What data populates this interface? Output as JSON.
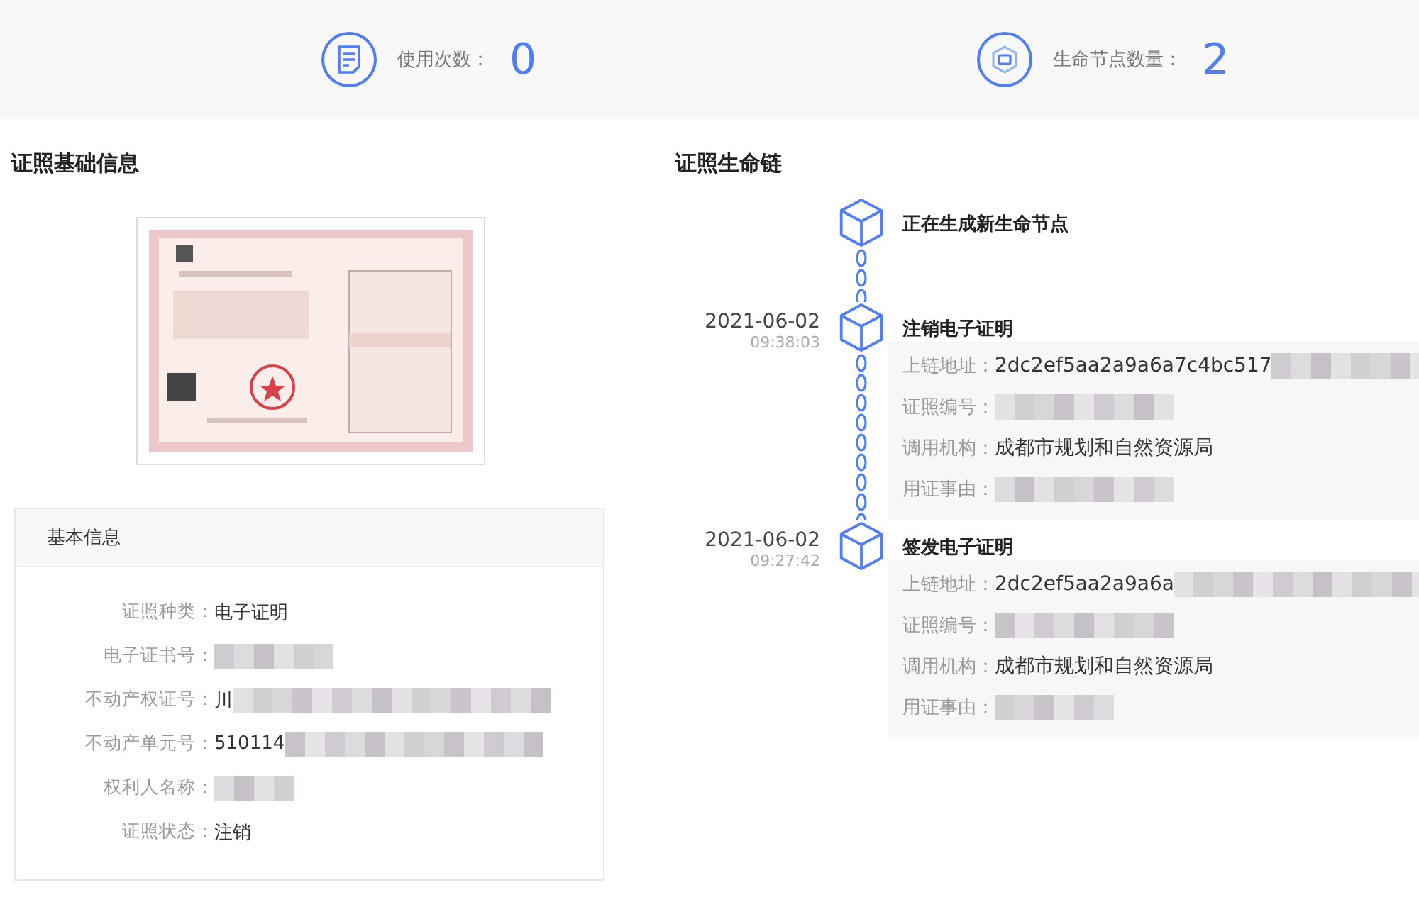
{
  "stats": [
    {
      "label": "使用次数：",
      "value": "0"
    },
    {
      "label": "生命节点数量：",
      "value": "2"
    }
  ],
  "certificate_info": {
    "title": "证照基础信息",
    "panel": {
      "title": "基本信息",
      "fields": [
        {
          "label": "证照种类：",
          "value": "电子证明",
          "redacted": false
        },
        {
          "label": "电子证书号：",
          "redacted": true
        },
        {
          "label": "不动产权证号：",
          "value": "川",
          "redacted": true
        },
        {
          "label": "不动产单元号：",
          "value": "510114",
          "redacted": true
        },
        {
          "label": "权利人名称：",
          "redacted": true
        },
        {
          "label": "证照状态：",
          "value": "注销",
          "redacted": false
        }
      ]
    }
  },
  "life_chain": {
    "title": "证照生命链",
    "nodes": [
      {
        "title": "正在生成新生命节点"
      },
      {
        "date": "2021-06-02",
        "time": "09:38:03",
        "title": "注销电子证明",
        "fields": [
          {
            "label": "上链地址：",
            "value": "2dc2ef5aa2a9a6a7c4bc517",
            "redacted": true
          },
          {
            "label": "证照编号：",
            "redacted": true
          },
          {
            "label": "调用机构：",
            "value": "成都市规划和自然资源局",
            "redacted": false
          },
          {
            "label": "用证事由：",
            "redacted": true
          }
        ]
      },
      {
        "date": "2021-06-02",
        "time": "09:27:42",
        "title": "签发电子证明",
        "fields": [
          {
            "label": "上链地址：",
            "value": "2dc2ef5aa2a9a6a",
            "redacted": true
          },
          {
            "label": "证照编号：",
            "redacted": true
          },
          {
            "label": "调用机构：",
            "value": "成都市规划和自然资源局",
            "redacted": false
          },
          {
            "label": "用证事由：",
            "redacted": true
          }
        ]
      }
    ]
  }
}
